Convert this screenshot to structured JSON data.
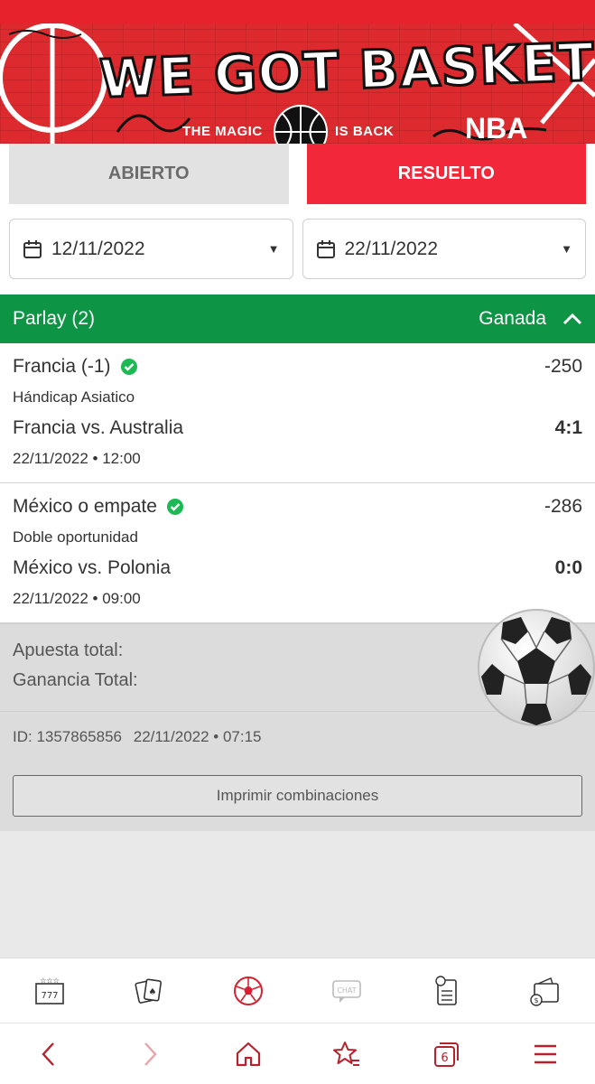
{
  "banner": {
    "title": "WE GOT BASKET",
    "tagline_left": "THE MAGIC",
    "tagline_right": "IS BACK",
    "league": "NBA"
  },
  "tabs": [
    {
      "label": "ABIERTO",
      "active": false
    },
    {
      "label": "RESUELTO",
      "active": true
    }
  ],
  "date_filters": {
    "from": "12/11/2022",
    "to": "22/11/2022"
  },
  "parlay": {
    "label": "Parlay (2)",
    "status": "Ganada",
    "bets": [
      {
        "selection": "Francia (-1)",
        "odds": "-250",
        "market": "Hándicap Asiatico",
        "match": "Francia vs. Australia",
        "score": "4:1",
        "datetime": "22/11/2022 • 12:00"
      },
      {
        "selection": "México o empate",
        "odds": "-286",
        "market": "Doble oportunidad",
        "match": "México vs. Polonia",
        "score": "0:0",
        "datetime": "22/11/2022 • 09:00"
      }
    ]
  },
  "summary": {
    "total_bet_label": "Apuesta total:",
    "total_win_label": "Ganancia Total:"
  },
  "meta": {
    "id": "ID: 1357865856",
    "datetime": "22/11/2022 • 07:15",
    "print_label": "Imprimir combinaciones"
  },
  "bottom_nav": {
    "items": [
      "slots-icon",
      "cards-icon",
      "soccer-ball-icon",
      "chat-icon",
      "betslip-icon",
      "wallet-icon"
    ],
    "chat_label": "CHAT",
    "active": "soccer-ball-icon"
  },
  "browser_bar": {
    "tabs_count": "6"
  },
  "colors": {
    "brand_red": "#f3273a",
    "win_green": "#0d9444",
    "check_green": "#1db954"
  }
}
